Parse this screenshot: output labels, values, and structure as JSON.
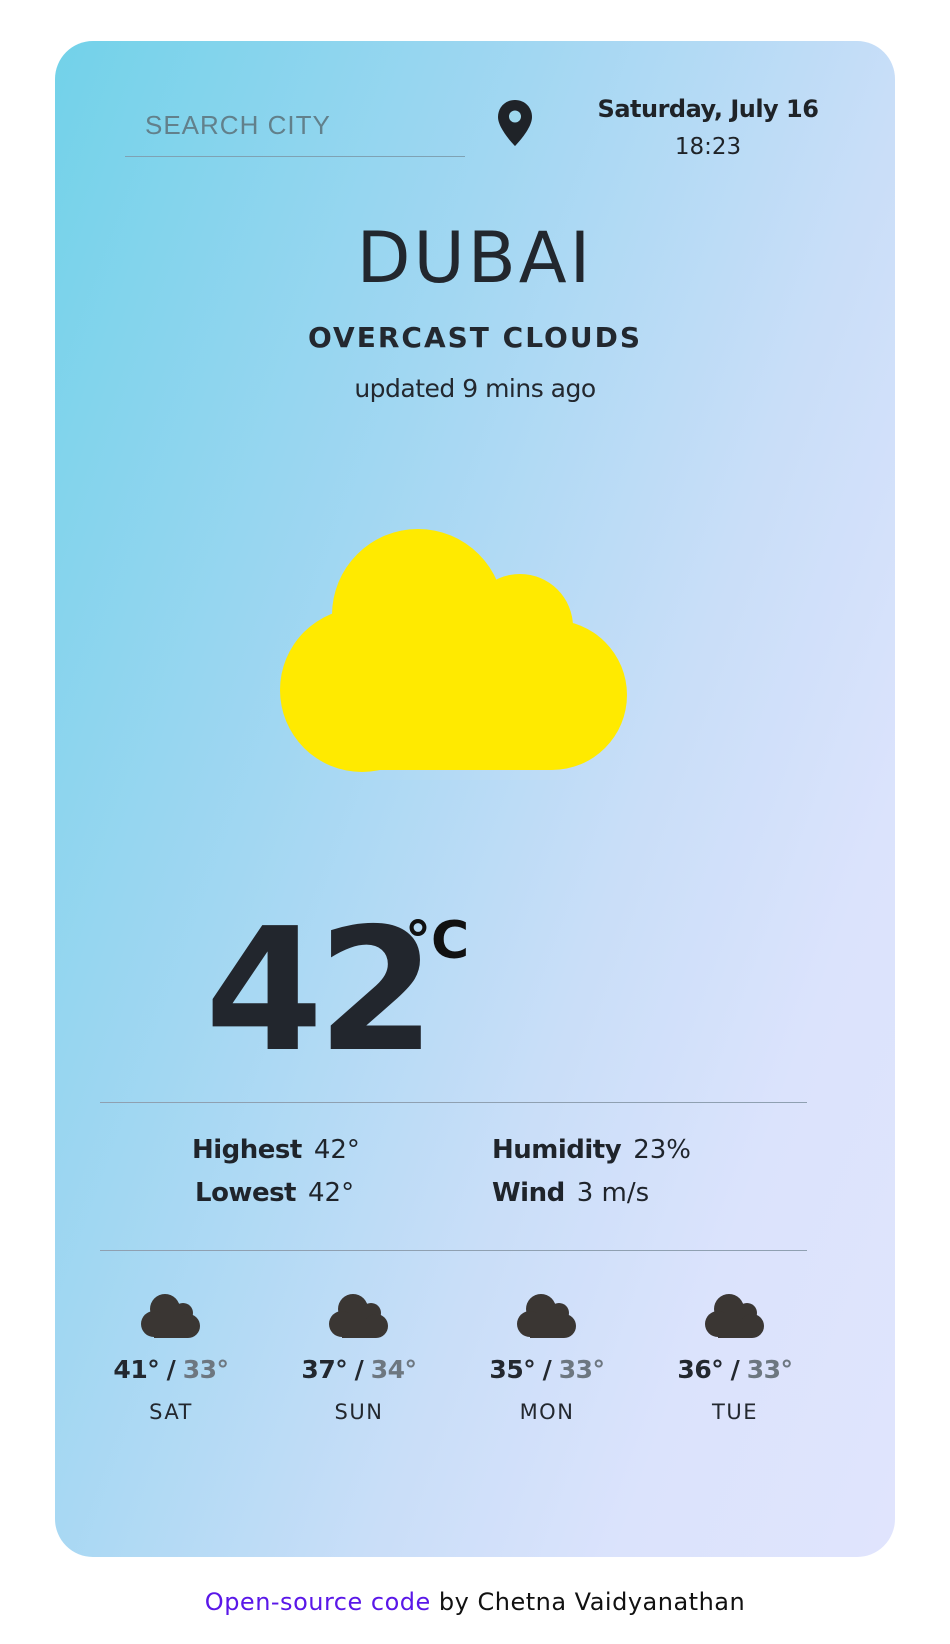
{
  "search": {
    "placeholder": "SEARCH CITY",
    "value": ""
  },
  "location_icon": "map-pin-icon",
  "header": {
    "date": "Saturday, July 16",
    "time": "18:23"
  },
  "current": {
    "city": "DUBAI",
    "condition": "OVERCAST CLOUDS",
    "updated": "updated 9 mins ago",
    "icon": "cloud-icon",
    "icon_color": "#ffea00",
    "temperature": "42",
    "unit": "°C"
  },
  "stats": {
    "highest_label": "Highest",
    "highest_value": "42°",
    "lowest_label": "Lowest",
    "lowest_value": "42°",
    "humidity_label": "Humidity",
    "humidity_value": "23%",
    "wind_label": "Wind",
    "wind_value": "3 m/s"
  },
  "forecast": [
    {
      "day": "SAT",
      "high": "41°",
      "low": "33°",
      "icon": "cloud-icon"
    },
    {
      "day": "SUN",
      "high": "37°",
      "low": "34°",
      "icon": "cloud-icon"
    },
    {
      "day": "MON",
      "high": "35°",
      "low": "33°",
      "icon": "cloud-icon"
    },
    {
      "day": "TUE",
      "high": "36°",
      "low": "33°",
      "icon": "cloud-icon"
    }
  ],
  "forecast_separator": "/",
  "footer": {
    "link_text": "Open-source code",
    "suffix": "by Chetna Vaidyanathan"
  },
  "colors": {
    "card_gradient_start": "#72d2e9",
    "card_gradient_end": "#e0e4fd",
    "link": "#5a17e8",
    "forecast_icon": "#3a3633"
  }
}
